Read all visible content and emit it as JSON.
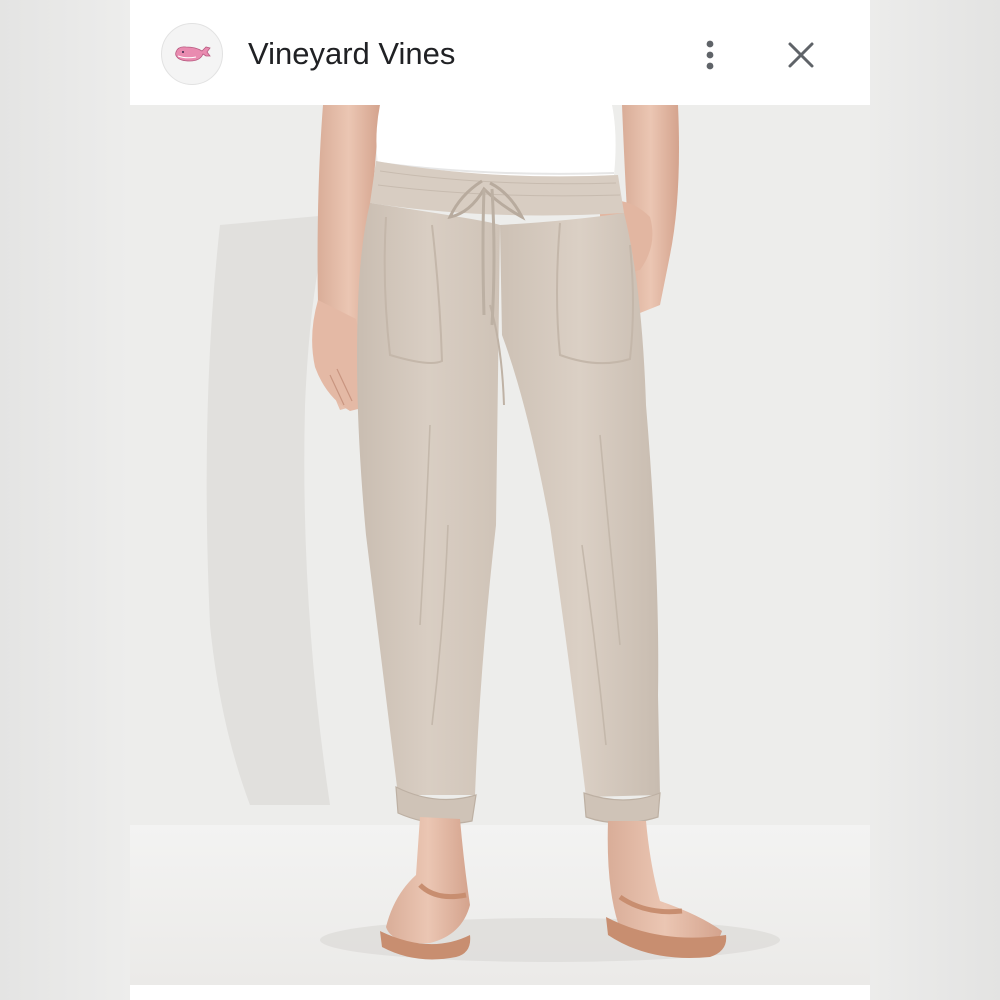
{
  "header": {
    "title": "Vineyard Vines",
    "logo_icon": "whale-logo-icon",
    "more_icon": "more-vertical-icon",
    "close_icon": "close-icon"
  },
  "photo": {
    "subject_icon": "product-photo-pants"
  },
  "colors": {
    "logo_whale": "#e98bb0",
    "title_text": "#202124",
    "icon_gray": "#5f6368",
    "pants": "#d6cbc0",
    "shirt": "#ffffff",
    "background": "#ececea"
  }
}
